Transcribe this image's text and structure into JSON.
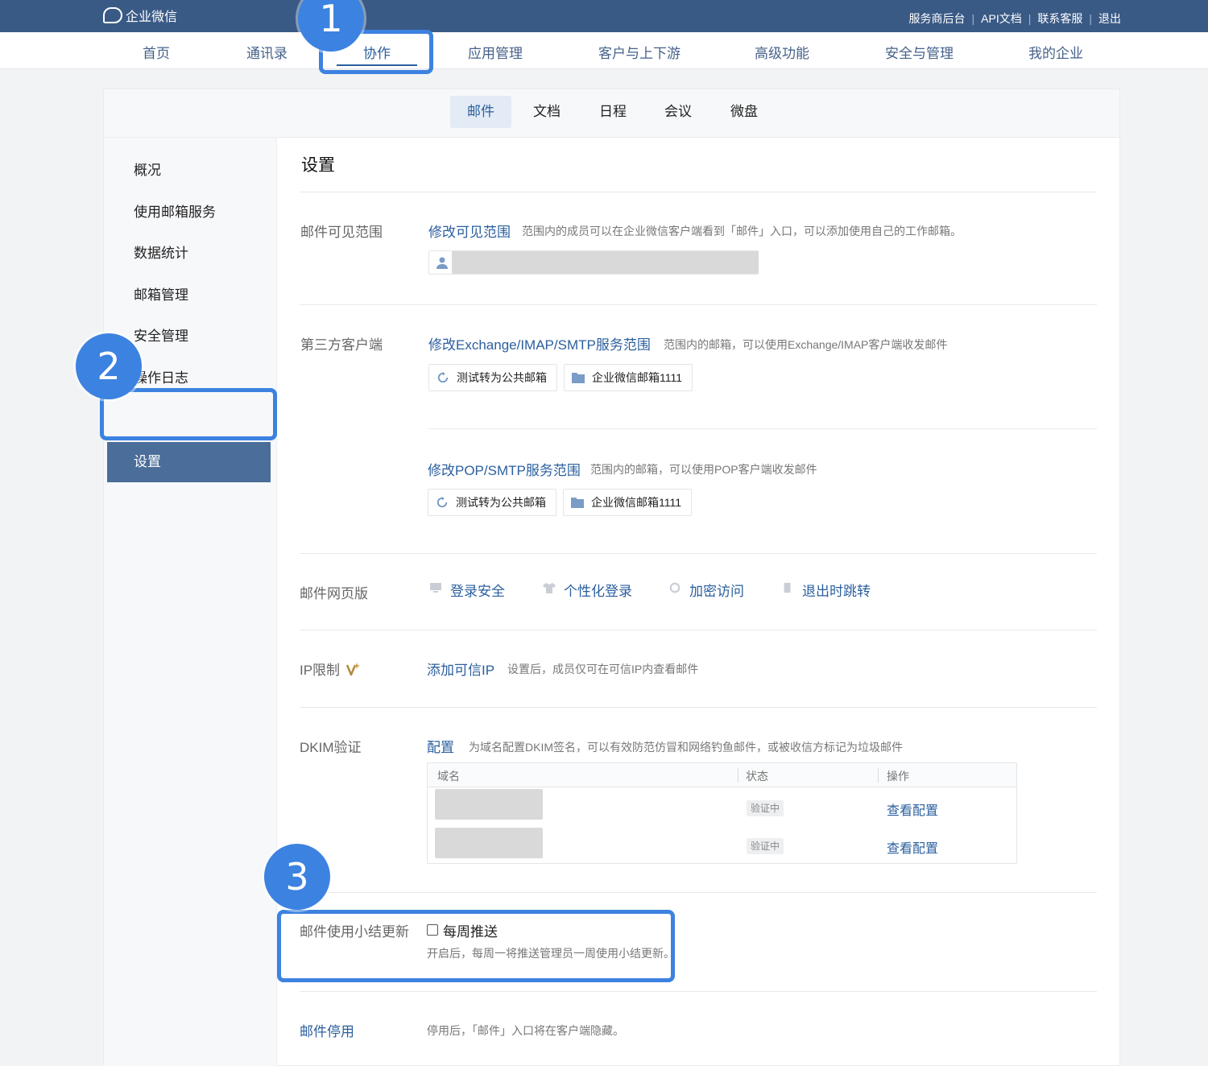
{
  "top": {
    "logo_text": "企业微信",
    "links": [
      "服务商后台",
      "API文档",
      "联系客服",
      "退出"
    ]
  },
  "nav": {
    "items": [
      "首页",
      "通讯录",
      "协作",
      "应用管理",
      "客户与上下游",
      "高级功能",
      "安全与管理",
      "我的企业"
    ],
    "active": "协作"
  },
  "subtabs": {
    "items": [
      "邮件",
      "文档",
      "日程",
      "会议",
      "微盘"
    ],
    "active": "邮件"
  },
  "sidebar": {
    "items": [
      "概况",
      "使用邮箱服务",
      "数据统计",
      "邮箱管理",
      "安全管理",
      "操作日志",
      "设置"
    ],
    "active": "设置"
  },
  "main": {
    "title": "设置",
    "visibility": {
      "label": "邮件可见范围",
      "link": "修改可见范围",
      "desc": "范围内的成员可以在企业微信客户端看到「邮件」入口，可以添加使用自己的工作邮箱。"
    },
    "third_party": {
      "label": "第三方客户端",
      "imap_link": "修改Exchange/IMAP/SMTP服务范围",
      "imap_desc": "范围内的邮箱，可以使用Exchange/IMAP客户端收发邮件",
      "pop_link": "修改POP/SMTP服务范围",
      "pop_desc": "范围内的邮箱，可以使用POP客户端收发邮件",
      "chip_public": "测试转为公共邮箱",
      "chip_group": "企业微信邮箱1111"
    },
    "web": {
      "label": "邮件网页版",
      "items": [
        "登录安全",
        "个性化登录",
        "加密访问",
        "退出时跳转"
      ]
    },
    "ip": {
      "label": "IP限制",
      "link": "添加可信IP",
      "desc": "设置后，成员仅可在可信IP内查看邮件"
    },
    "dkim": {
      "label": "DKIM验证",
      "link": "配置",
      "desc": "为域名配置DKIM签名，可以有效防范仿冒和网络钓鱼邮件，或被收信方标记为垃圾邮件",
      "headers": [
        "域名",
        "状态",
        "操作"
      ],
      "rows": [
        {
          "status": "验证中",
          "action": "查看配置"
        },
        {
          "status": "验证中",
          "action": "查看配置"
        }
      ]
    },
    "summary": {
      "label": "邮件使用小结更新",
      "checkbox_label": "每周推送",
      "desc": "开启后，每周一将推送管理员一周使用小结更新。"
    },
    "disable": {
      "label": "邮件停用",
      "desc": "停用后，「邮件」入口将在客户端隐藏。"
    }
  },
  "annotations": [
    "1",
    "2",
    "3"
  ],
  "colors": {
    "topbar": "#3a5a86",
    "accent": "#2b5f9e",
    "sidebar_active": "#4a6d99",
    "annotation": "#3c82e0"
  }
}
